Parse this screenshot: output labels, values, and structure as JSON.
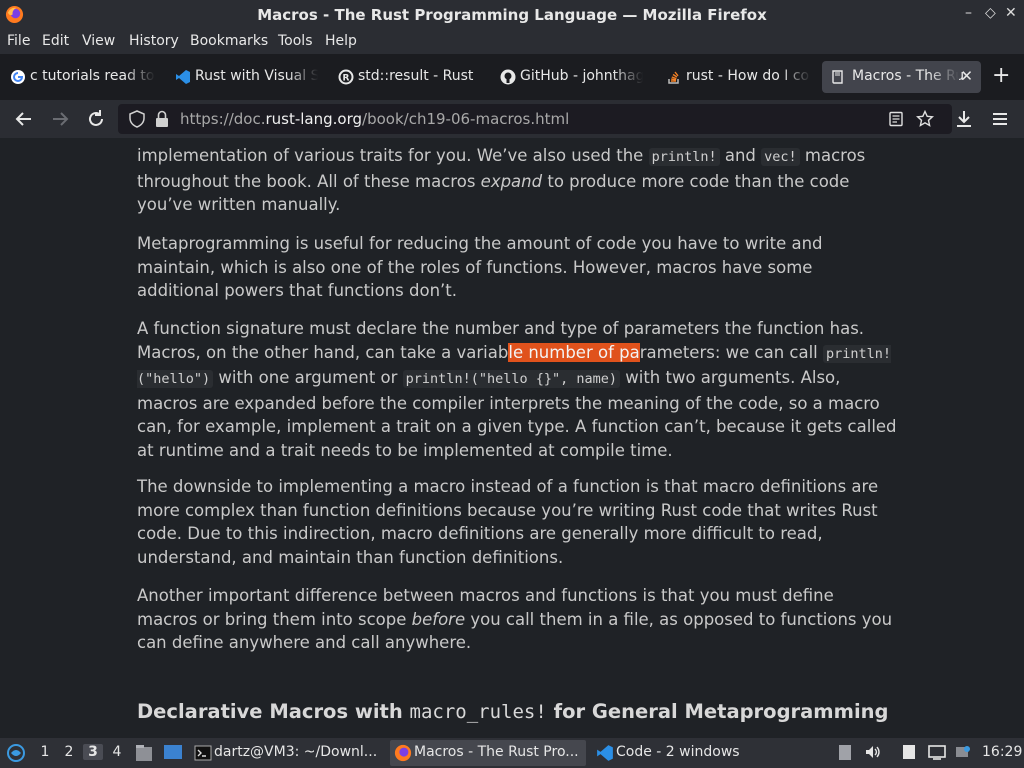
{
  "window": {
    "title": "Macros - The Rust Programming Language — Mozilla Firefox",
    "controls": {
      "minimize": "–",
      "restore": "◇",
      "close": "✕"
    }
  },
  "menu": [
    "File",
    "Edit",
    "View",
    "History",
    "Bookmarks",
    "Tools",
    "Help"
  ],
  "tabs": [
    {
      "label": "c tutorials read to",
      "icon": "google-icon"
    },
    {
      "label": "Rust with Visual S",
      "icon": "vscode-icon"
    },
    {
      "label": "std::result - Rust",
      "icon": "rust-icon"
    },
    {
      "label": "GitHub - johnthag",
      "icon": "github-icon"
    },
    {
      "label": "rust - How do I co",
      "icon": "stackoverflow-icon"
    },
    {
      "label": "Macros - The Ru",
      "icon": "book-icon",
      "active": true
    }
  ],
  "nav": {
    "url_prefix": "https://doc.",
    "url_domain": "rust-lang.org",
    "url_path": "/book/ch19-06-macros.html"
  },
  "content": {
    "p1": {
      "a": "implementation of various traits for you. We’ve also used the ",
      "code1": "println!",
      "b": " and ",
      "code2": "vec!",
      "c": " macros throughout the book. All of these macros ",
      "em": "expand",
      "d": " to produce more code than the code you’ve written manually."
    },
    "p2": "Metaprogramming is useful for reducing the amount of code you have to write and maintain, which is also one of the roles of functions. However, macros have some additional powers that functions don’t.",
    "p3": {
      "a": "A function signature must declare the number and type of parameters the function has. Macros, on the other hand, can take a variab",
      "hl_a": "le number of pa",
      "b": "rameters: we can call ",
      "code1": "println!(\"hello\")",
      "c": " with one argument or ",
      "code2": "println!(\"hello {}\", name)",
      "d": " with two arguments. Also, macros are expanded before the compiler interprets the meaning of the code, so a macro can, for example, implement a trait on a given type. A function can’t, because it gets called at runtime and a trait needs to be implemented at compile time."
    },
    "p4": "The downside to implementing a macro instead of a function is that macro definitions are more complex than function definitions because you’re writing Rust code that writes Rust code. Due to this indirection, macro definitions are generally more difficult to read, understand, and maintain than function definitions.",
    "p5": {
      "a": "Another important difference between macros and functions is that you must define macros or bring them into scope ",
      "em": "before",
      "b": " you call them in a file, as opposed to functions you can define anywhere and call anywhere."
    },
    "heading": {
      "a": "Declarative Macros with ",
      "code": "macro_rules!",
      "b": " for General Metaprogramming"
    }
  },
  "taskbar": {
    "workspaces": [
      "1",
      "2",
      "3",
      "4"
    ],
    "active_workspace": "3",
    "tasks": [
      {
        "label": "dartz@VM3: ~/Downl...",
        "icon": "terminal-icon"
      },
      {
        "label": "Macros - The Rust Pro...",
        "icon": "firefox-icon",
        "active": true
      },
      {
        "label": "Code - 2 windows",
        "icon": "vscode-icon"
      }
    ],
    "clock": "16:29"
  },
  "colors": {
    "highlight": "#e0521c",
    "background": "#1f2226",
    "chrome": "#2b2d33"
  }
}
